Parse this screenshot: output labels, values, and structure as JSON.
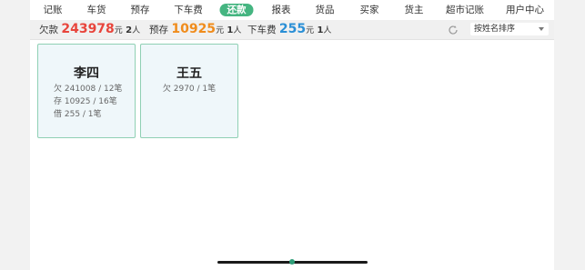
{
  "nav": {
    "items": [
      {
        "label": "记账"
      },
      {
        "label": "车货"
      },
      {
        "label": "预存"
      },
      {
        "label": "下车费"
      },
      {
        "label": "还款"
      },
      {
        "label": "报表"
      },
      {
        "label": "货品"
      },
      {
        "label": "买家"
      },
      {
        "label": "货主"
      },
      {
        "label": "超市记账"
      },
      {
        "label": "用户中心"
      }
    ],
    "active_index": 4
  },
  "summary": {
    "debt": {
      "label": "欠款",
      "value": "243978",
      "unit": "元",
      "count": "2",
      "count_unit": "人",
      "color": "#e8453c"
    },
    "prepaid": {
      "label": "预存",
      "value": "10925",
      "unit": "元",
      "count": "1",
      "count_unit": "人",
      "color": "#f08c1c"
    },
    "unloading": {
      "label": "下车费",
      "value": "255",
      "unit": "元",
      "count": "1",
      "count_unit": "人",
      "color": "#2a8fd6"
    },
    "refresh_icon": "refresh-icon",
    "sort": {
      "selected": "按姓名排序"
    }
  },
  "cards": [
    {
      "name": "李四",
      "lines": [
        "欠 241008 / 12笔",
        "存 10925 / 16笔",
        "借 255 / 1笔"
      ]
    },
    {
      "name": "王五",
      "lines": [
        "欠 2970 / 1笔"
      ]
    }
  ],
  "colors": {
    "accent": "#45b581",
    "card_bg": "#eff7fa",
    "card_border": "#8fd0b4"
  }
}
